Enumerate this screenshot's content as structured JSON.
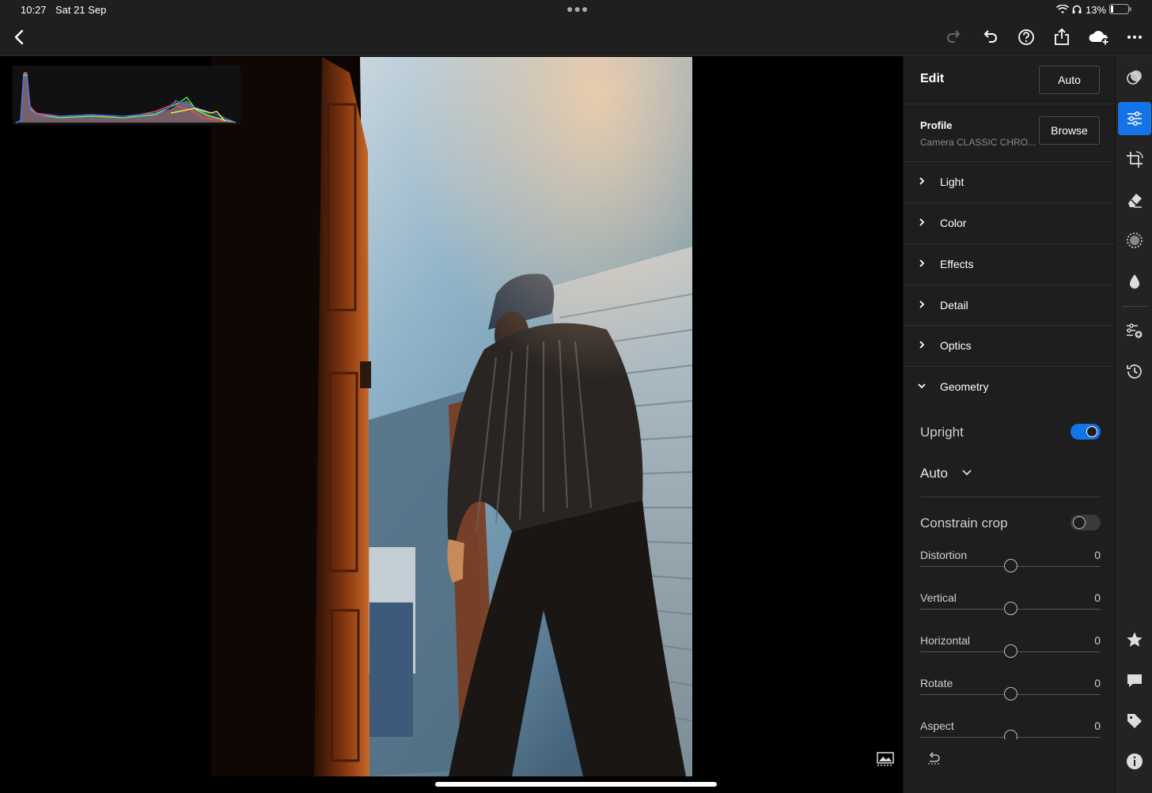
{
  "status_bar": {
    "time": "10:27",
    "date": "Sat 21 Sep",
    "battery": "13%",
    "icons": [
      "wifi-icon",
      "headphones-icon",
      "battery-icon"
    ]
  },
  "toolbar": {
    "back_icon": "back-chevron-icon",
    "right_icons": [
      "redo-icon",
      "undo-icon",
      "help-icon",
      "share-icon",
      "cloud-add-icon",
      "more-icon"
    ]
  },
  "edit_panel": {
    "title": "Edit",
    "auto_button": "Auto",
    "profile": {
      "label": "Profile",
      "value": "Camera CLASSIC CHRO...",
      "browse_button": "Browse"
    },
    "sections": [
      {
        "label": "Light",
        "expanded": false
      },
      {
        "label": "Color",
        "expanded": false
      },
      {
        "label": "Effects",
        "expanded": false
      },
      {
        "label": "Detail",
        "expanded": false
      },
      {
        "label": "Optics",
        "expanded": false
      },
      {
        "label": "Geometry",
        "expanded": true
      }
    ],
    "geometry": {
      "upright_label": "Upright",
      "upright_on": true,
      "upright_mode": "Auto",
      "constrain_crop_label": "Constrain crop",
      "constrain_crop_on": false,
      "sliders": [
        {
          "name": "Distortion",
          "value": "0",
          "position": 0.5
        },
        {
          "name": "Vertical",
          "value": "0",
          "position": 0.5
        },
        {
          "name": "Horizontal",
          "value": "0",
          "position": 0.5
        },
        {
          "name": "Rotate",
          "value": "0",
          "position": 0.5
        },
        {
          "name": "Aspect",
          "value": "0",
          "position": 0.5
        }
      ]
    },
    "reset_icon": "reset-icon"
  },
  "tool_rail": {
    "icons": [
      "presets-icon",
      "edit-sliders-icon",
      "crop-icon",
      "healing-icon",
      "masking-icon",
      "blur-icon",
      "versions-icon",
      "history-icon",
      "star-icon",
      "comment-icon",
      "tag-icon",
      "info-icon"
    ],
    "active": "edit-sliders-icon",
    "accent": "#1473e6"
  },
  "canvas": {
    "compare_icon": "before-after-icon"
  }
}
